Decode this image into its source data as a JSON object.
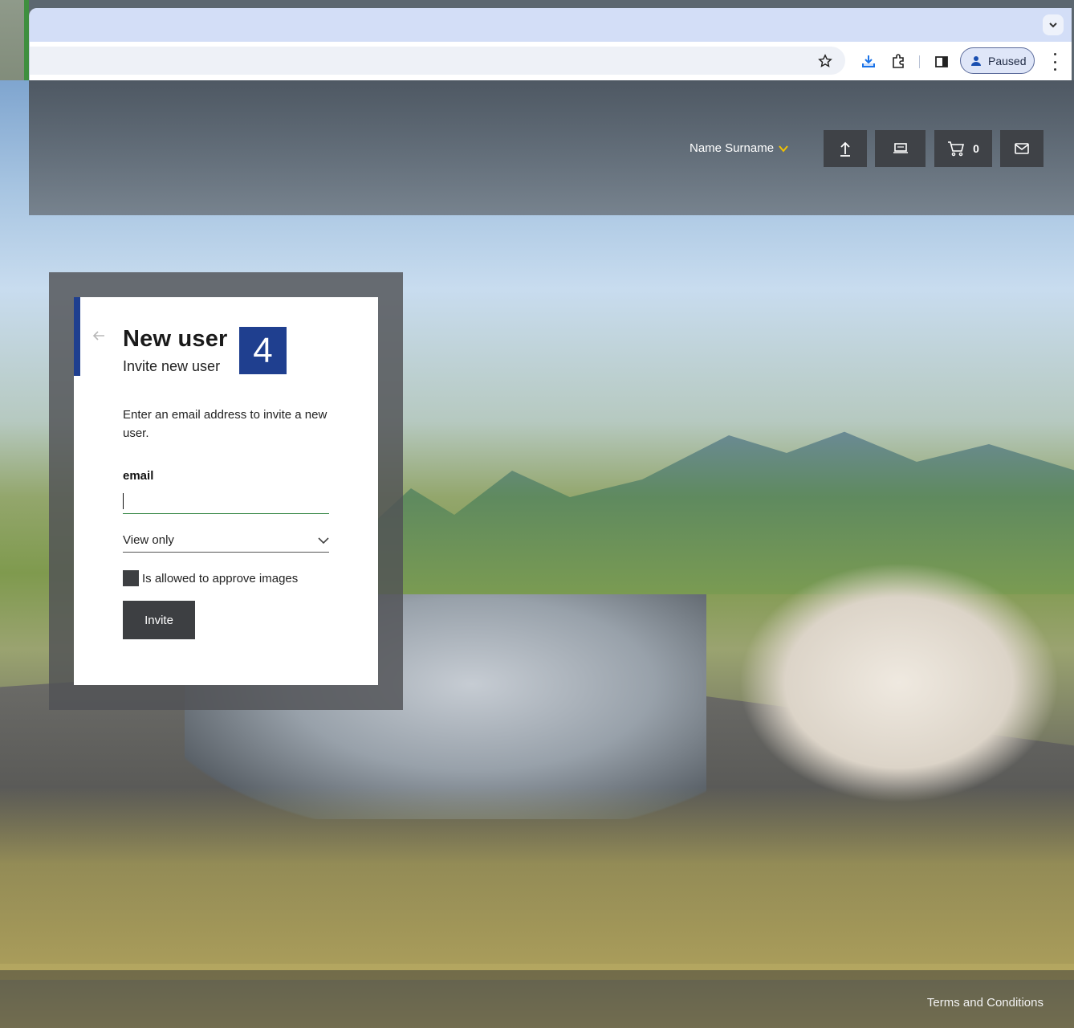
{
  "browser": {
    "profile_label": "Paused"
  },
  "header": {
    "user_name": "Name Surname",
    "cart_count": "0",
    "buttons": [
      "upload-icon",
      "screen-icon",
      "cart-icon",
      "mail-icon"
    ]
  },
  "modal": {
    "title": "New user",
    "subtitle": "Invite new user",
    "step": "4",
    "description": "Enter an email address to invite a new user.",
    "email_label": "email",
    "email_value": "",
    "role_selected": "View only",
    "checkbox_label": "Is allowed to approve images",
    "checkbox_checked": false,
    "invite_label": "Invite"
  },
  "footer": {
    "terms_label": "Terms and Conditions"
  },
  "colors": {
    "accent": "#1f3f8f",
    "user_chevron": "#f2c200",
    "dark_button": "#3d3f42",
    "input_underline": "#3a8a4a"
  }
}
